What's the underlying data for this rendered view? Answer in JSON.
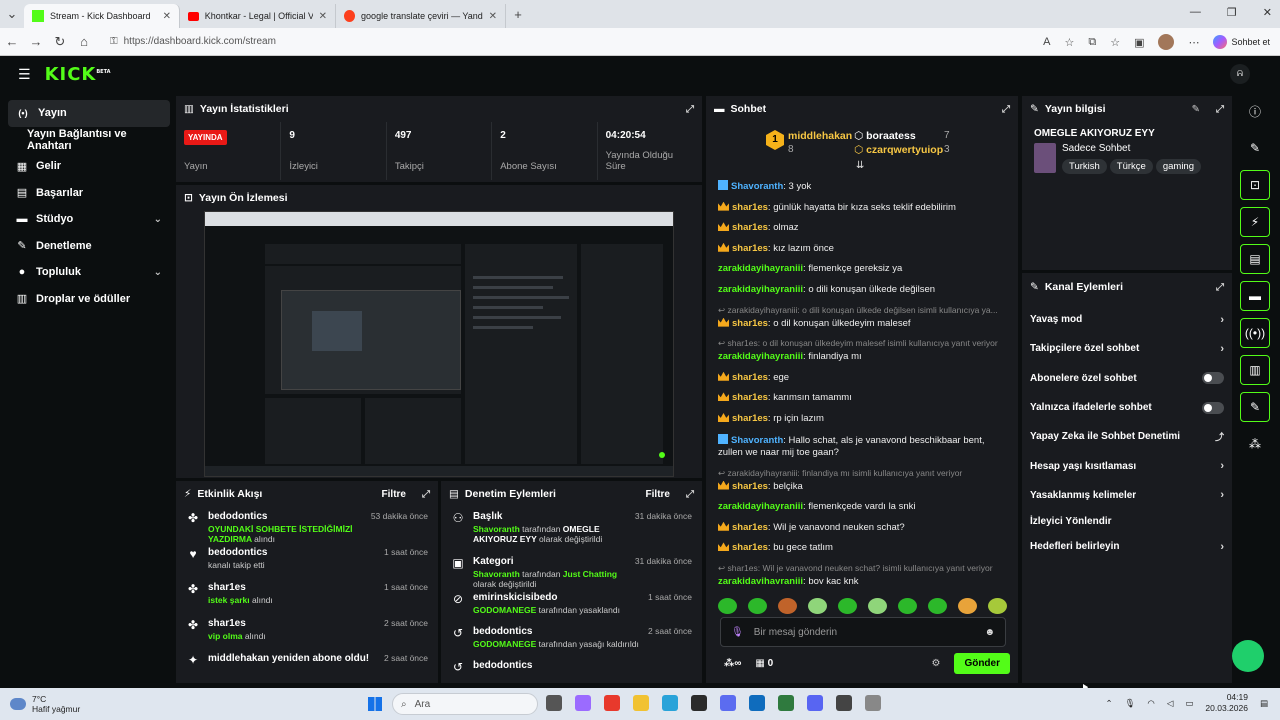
{
  "browser": {
    "tabs": [
      {
        "title": "Stream - Kick Dashboard",
        "active": true
      },
      {
        "title": "Khontkar - Legal | Official Video -",
        "active": false
      },
      {
        "title": "google translate çeviri — Yandex",
        "active": false
      }
    ],
    "url": "https://dashboard.kick.com/stream",
    "copilot": "Sohbet et"
  },
  "app": {
    "logo": "KICK",
    "logo_sup": "BETA",
    "user_initial": "ᕱ"
  },
  "sidebar": {
    "items": [
      {
        "label": "Yayın",
        "icon": "broadcast-icon",
        "glyph": "(•)"
      },
      {
        "label": "Yayın Bağlantısı ve Anahtarı",
        "icon": "",
        "glyph": ""
      },
      {
        "label": "Gelir",
        "icon": "revenue-icon",
        "glyph": "▦"
      },
      {
        "label": "Başarılar",
        "icon": "achievements-icon",
        "glyph": "▤"
      },
      {
        "label": "Stüdyo",
        "icon": "studio-icon",
        "glyph": "▬"
      },
      {
        "label": "Denetleme",
        "icon": "wrench-icon",
        "glyph": "✎"
      },
      {
        "label": "Topluluk",
        "icon": "community-icon",
        "glyph": "●"
      },
      {
        "label": "Droplar ve ödüller",
        "icon": "drops-icon",
        "glyph": "▥"
      }
    ]
  },
  "stats": {
    "title": "Yayın İstatistikleri",
    "live_badge": "YAYINDA",
    "live_label": "Yayın",
    "viewers_value": "9",
    "viewers_label": "İzleyici",
    "followers_value": "497",
    "followers_label": "Takipçi",
    "subs_value": "2",
    "subs_label": "Abone Sayısı",
    "duration_value": "04:20:54",
    "duration_label": "Yayında Olduğu Süre"
  },
  "preview": {
    "title": "Yayın Ön İzlemesi"
  },
  "activity": {
    "title": "Etkinlik Akışı",
    "filter": "Filtre",
    "items": [
      {
        "name": "bedodontics",
        "sub": "OYUNDAKİ SOHBETE İSTEDİĞİMİZİ YAZDIRMA",
        "sub2": "alındı",
        "time": "53 dakika önce",
        "icon": "gift-icon"
      },
      {
        "name": "bedodontics",
        "sub": "",
        "sub2": "kanalı takip etti",
        "time": "1 saat önce",
        "icon": "heart-icon"
      },
      {
        "name": "shar1es",
        "sub": "istek şarkı",
        "sub2": "alındı",
        "time": "1 saat önce",
        "icon": "gift-icon"
      },
      {
        "name": "shar1es",
        "sub": "vip olma",
        "sub2": "alındı",
        "time": "2 saat önce",
        "icon": "gift-icon"
      },
      {
        "name": "middlehakan yeniden abone oldu!",
        "sub": "",
        "sub2": "",
        "time": "2 saat önce",
        "icon": "sparkle-icon"
      }
    ]
  },
  "moderation": {
    "title": "Denetim Eylemleri",
    "filter": "Filtre",
    "items": [
      {
        "name": "Başlık",
        "actor": "Shavoranth",
        "mid": "tarafından",
        "target": "OMEGLE AKIYORUZ EYY",
        "end": "olarak değiştirildi",
        "time": "31 dakika önce",
        "icon": "title-icon"
      },
      {
        "name": "Kategori",
        "actor": "Shavoranth",
        "mid": "tarafından",
        "target": "Just Chatting",
        "end": "olarak değiştirildi",
        "time": "31 dakika önce",
        "icon": "category-icon"
      },
      {
        "name": "emirinskicisibedo",
        "actor": "GODOMANEGE",
        "mid": "tarafından yasaklandı",
        "target": "",
        "end": "",
        "time": "1 saat önce",
        "icon": "ban-icon"
      },
      {
        "name": "bedodontics",
        "actor": "GODOMANEGE",
        "mid": "tarafından yasağı kaldırıldı",
        "target": "",
        "end": "",
        "time": "2 saat önce",
        "icon": "unban-icon"
      },
      {
        "name": "bedodontics",
        "actor": "",
        "mid": "",
        "target": "",
        "end": "",
        "time": "",
        "icon": "unban-icon"
      }
    ]
  },
  "chat": {
    "title": "Sohbet",
    "top1_name": "middlehakan",
    "top1_count": "8",
    "top1_rank": "1",
    "top2_name": "boraatess",
    "top2_count": "7",
    "top3_name": "czarqwertyuiop",
    "top3_count": "3",
    "messages": [
      {
        "reply": "",
        "user": "Shavoranth",
        "color": "b",
        "badge": "b",
        "text": "3 yok"
      },
      {
        "reply": "",
        "user": "shar1es",
        "color": "y",
        "badge": "c",
        "text": "günlük hayatta bir kıza seks teklif edebilirim"
      },
      {
        "reply": "",
        "user": "shar1es",
        "color": "y",
        "badge": "c",
        "text": "olmaz"
      },
      {
        "reply": "",
        "user": "shar1es",
        "color": "y",
        "badge": "c",
        "text": "kız lazım önce"
      },
      {
        "reply": "",
        "user": "zarakidayihayraniii",
        "color": "g",
        "badge": "",
        "text": "flemenkçe gereksiz ya"
      },
      {
        "reply": "",
        "user": "zarakidayihayraniii",
        "color": "g",
        "badge": "",
        "text": "o dili konuşan ülkede değilsen"
      },
      {
        "reply": "zarakidayihayraniii: o dili konuşan ülkede değilsen isimli kullanıcıya ya...",
        "user": "shar1es",
        "color": "y",
        "badge": "c",
        "text": "o dil konuşan ülkedeyim malesef"
      },
      {
        "reply": "shar1es: o dil konuşan ülkedeyim malesef isimli kullanıcıya yanıt veriyor",
        "user": "zarakidayihayraniii",
        "color": "g",
        "badge": "",
        "text": "finlandiya mı"
      },
      {
        "reply": "",
        "user": "shar1es",
        "color": "y",
        "badge": "c",
        "text": "ege"
      },
      {
        "reply": "",
        "user": "shar1es",
        "color": "y",
        "badge": "c",
        "text": "karımsın tamammı"
      },
      {
        "reply": "",
        "user": "shar1es",
        "color": "y",
        "badge": "c",
        "text": "rp için lazım"
      },
      {
        "reply": "",
        "user": "Shavoranth",
        "color": "b",
        "badge": "b",
        "text": "Hallo schat, als je vanavond beschikbaar bent, zullen we naar mij toe gaan?"
      },
      {
        "reply": "zarakidayihayraniii: finlandiya mı isimli kullanıcıya yanıt veriyor",
        "user": "shar1es",
        "color": "y",
        "badge": "c",
        "text": "belçika"
      },
      {
        "reply": "",
        "user": "zarakidayihayraniii",
        "color": "g",
        "badge": "",
        "text": "flemenkçede vardı la snki"
      },
      {
        "reply": "",
        "user": "shar1es",
        "color": "y",
        "badge": "c",
        "text": "Wil je vanavond neuken schat?"
      },
      {
        "reply": "",
        "user": "shar1es",
        "color": "y",
        "badge": "c",
        "text": "bu gece tatlım"
      },
      {
        "reply": "shar1es: Wil je vanavond neuken schat? isimli kullanıcıya yanıt veriyor",
        "user": "zarakidayihayraniii",
        "color": "g",
        "badge": "",
        "text": "boy kaç knk"
      }
    ],
    "input_placeholder": "Bir mesaj gönderin",
    "points": "0",
    "send": "Gönder"
  },
  "info": {
    "title": "Yayın bilgisi",
    "stream_title": "OMEGLE AKIYORUZ EYY",
    "category": "Sadece Sohbet",
    "tags": [
      "Turkish",
      "Türkçe",
      "gaming"
    ]
  },
  "actions": {
    "title": "Kanal Eylemleri",
    "items": [
      {
        "label": "Yavaş mod",
        "kind": "arrow"
      },
      {
        "label": "Takipçilere özel sohbet",
        "kind": "arrow"
      },
      {
        "label": "Abonelere özel sohbet",
        "kind": "toggle"
      },
      {
        "label": "Yalnızca ifadelerle sohbet",
        "kind": "toggle"
      },
      {
        "label": "Yapay Zeka ile Sohbet Denetimi",
        "kind": "external"
      },
      {
        "label": "Hesap yaşı kısıtlaması",
        "kind": "arrow"
      },
      {
        "label": "Yasaklanmış kelimeler",
        "kind": "arrow"
      },
      {
        "label": "İzleyici Yönlendir",
        "kind": "none"
      },
      {
        "label": "Hedefleri belirleyin",
        "kind": "arrow"
      }
    ]
  },
  "taskbar": {
    "temp": "7°C",
    "weather": "Hafif yağmur",
    "search": "Ara",
    "time": "04:19",
    "date": "20.03.2026"
  }
}
